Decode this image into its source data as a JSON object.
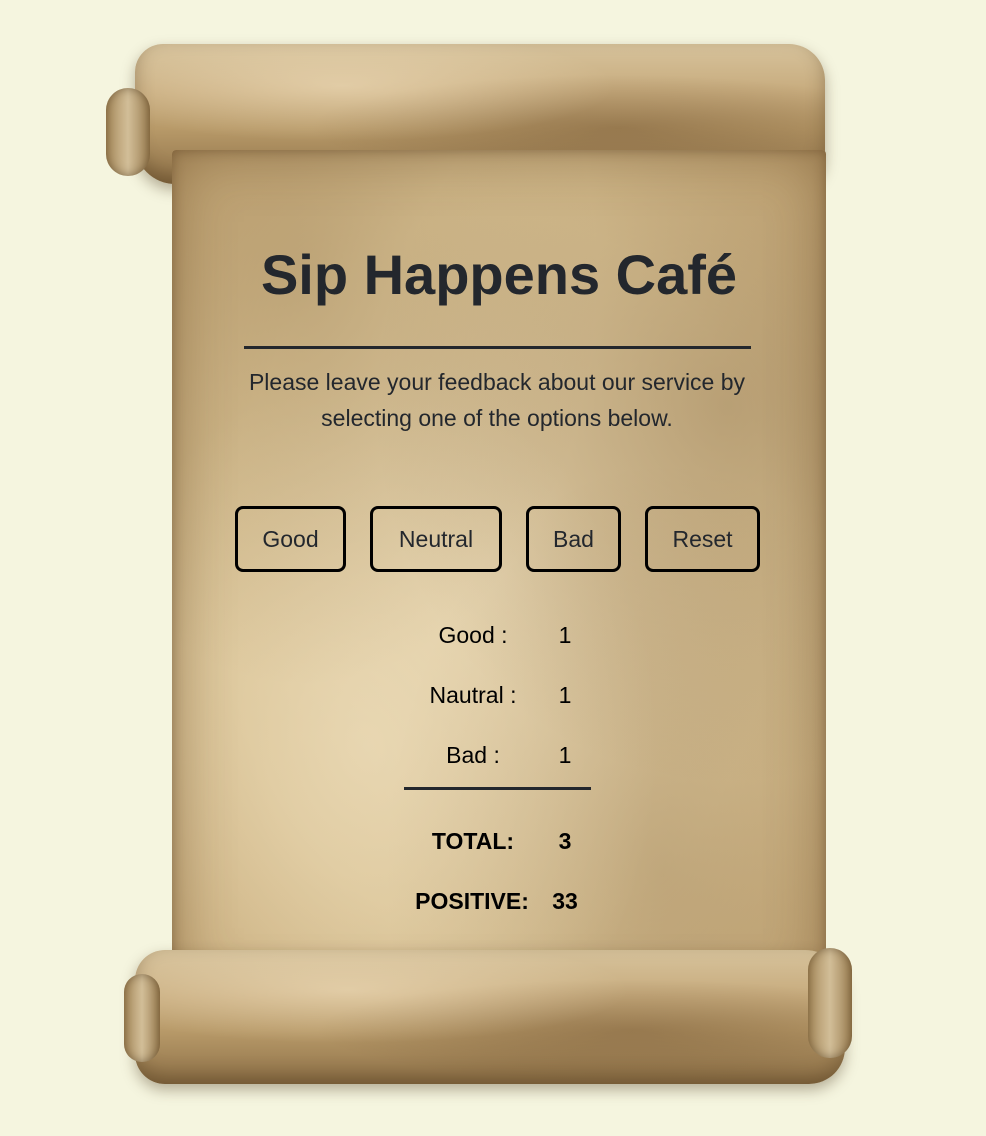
{
  "header": {
    "title": "Sip Happens Café",
    "subtitle": "Please leave your feedback about our service by selecting one of the options below."
  },
  "buttons": {
    "good": "Good",
    "neutral": "Neutral",
    "bad": "Bad",
    "reset": "Reset"
  },
  "stats": {
    "good_label": "Good :",
    "good_value": "1",
    "neutral_label": "Nautral :",
    "neutral_value": "1",
    "bad_label": "Bad :",
    "bad_value": "1",
    "total_label": "TOTAL:",
    "total_value": "3",
    "positive_label": "POSITIVE:",
    "positive_value": "33"
  },
  "colors": {
    "page_background": "#f5f5df",
    "text": "#23272d",
    "parchment": "#d8c193"
  }
}
